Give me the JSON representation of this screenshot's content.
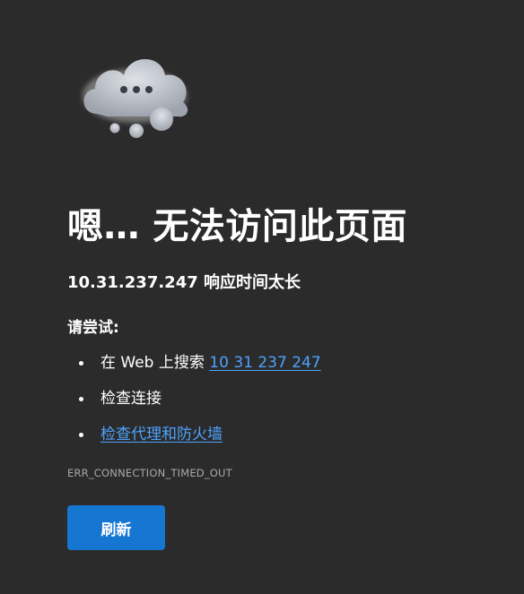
{
  "illustration": {
    "icon": "cloud-icon",
    "colors": {
      "cloud": "#c3c7cf",
      "dots": "#3a3d42"
    }
  },
  "title": "嗯… 无法访问此页面",
  "subtitle": "10.31.237.247 响应时间太长",
  "try_heading": "请尝试:",
  "suggestions": {
    "search_prefix": "在 Web 上搜索 ",
    "search_link": "10 31 237 247",
    "check_connection": "检查连接",
    "check_proxy_firewall": "检查代理和防火墙"
  },
  "error_code": "ERR_CONNECTION_TIMED_OUT",
  "refresh_button": "刷新",
  "colors": {
    "background": "#2b2b2b",
    "link": "#4da3ff",
    "button": "#1677d2"
  }
}
